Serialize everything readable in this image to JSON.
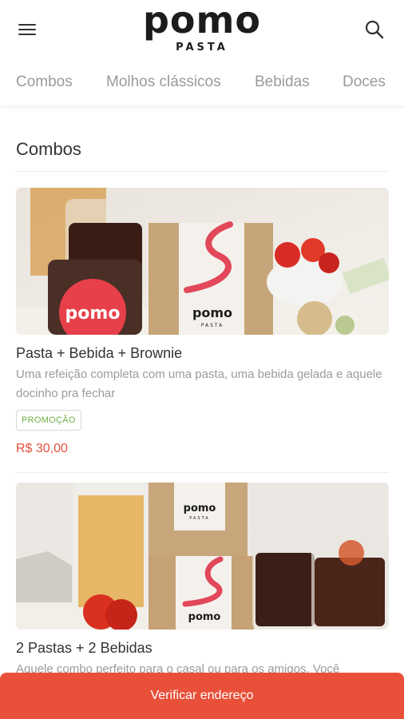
{
  "header": {
    "logo_word": "pomo",
    "logo_sub": "PASTA"
  },
  "tabs": [
    {
      "label": "Combos"
    },
    {
      "label": "Molhos clássicos"
    },
    {
      "label": "Bebidas"
    },
    {
      "label": "Doces"
    }
  ],
  "section": {
    "title": "Combos"
  },
  "products": [
    {
      "name": "Pasta + Bebida + Brownie",
      "description": "Uma refeição completa com uma pasta, uma bebida gelada e aquele docinho pra fechar",
      "badge": "PROMOÇÃO",
      "price": "R$ 30,00",
      "image_labels": [
        "pomo",
        "pomo",
        "PASTA"
      ]
    },
    {
      "name": "2 Pastas + 2 Bebidas",
      "description": "Aquele combo perfeito para o casal ou para os amigos. Você",
      "image_labels": [
        "pomo",
        "PASTA",
        "pomo"
      ]
    }
  ],
  "cta": {
    "label": "Verificar endereço"
  },
  "colors": {
    "accent": "#e8503a",
    "badge_text": "#6fb04a",
    "tab_text": "#9a9a9a"
  },
  "icons": {
    "menu": "hamburger-icon",
    "search": "search-icon"
  }
}
